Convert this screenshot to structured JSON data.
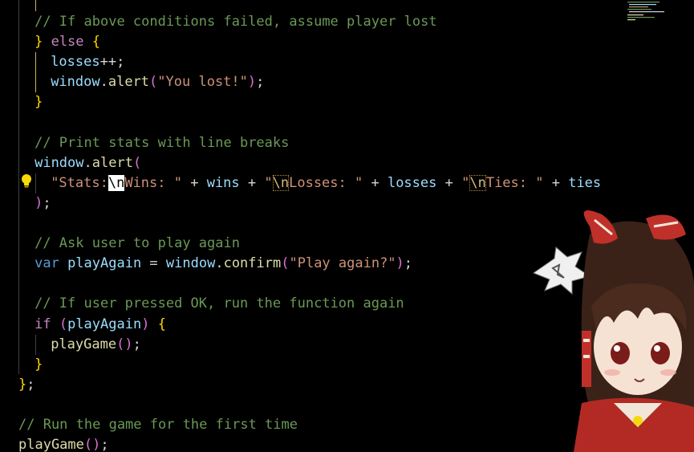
{
  "editor": {
    "lines": [
      {
        "tokens": [
          {
            "t": "// If above conditions failed, assume player lost",
            "c": "comment"
          }
        ]
      },
      {
        "tokens": [
          {
            "t": "} ",
            "c": "brace"
          },
          {
            "t": "else",
            "c": "control"
          },
          {
            "t": " {",
            "c": "brace"
          }
        ]
      },
      {
        "tokens": [
          {
            "t": "losses",
            "c": "var"
          },
          {
            "t": "++;",
            "c": "plain"
          }
        ]
      },
      {
        "tokens": [
          {
            "t": "window",
            "c": "var"
          },
          {
            "t": ".",
            "c": "plain"
          },
          {
            "t": "alert",
            "c": "func"
          },
          {
            "t": "(",
            "c": "paren"
          },
          {
            "t": "\"You lost!\"",
            "c": "string"
          },
          {
            "t": ")",
            "c": "paren"
          },
          {
            "t": ";",
            "c": "plain"
          }
        ]
      },
      {
        "tokens": [
          {
            "t": "}",
            "c": "brace"
          }
        ]
      },
      {
        "tokens": []
      },
      {
        "tokens": [
          {
            "t": "// Print stats with line breaks",
            "c": "comment"
          }
        ]
      },
      {
        "tokens": [
          {
            "t": "window",
            "c": "var"
          },
          {
            "t": ".",
            "c": "plain"
          },
          {
            "t": "alert",
            "c": "func"
          },
          {
            "t": "(",
            "c": "paren"
          }
        ]
      },
      {
        "tokens": [
          {
            "t": "\"Stats:",
            "c": "string"
          },
          {
            "t": "\\n",
            "c": "escape-cursor"
          },
          {
            "t": "Wins: \"",
            "c": "string"
          },
          {
            "t": " + ",
            "c": "plain"
          },
          {
            "t": "wins",
            "c": "var"
          },
          {
            "t": " + ",
            "c": "plain"
          },
          {
            "t": "\"",
            "c": "string"
          },
          {
            "t": "\\n",
            "c": "escape-box"
          },
          {
            "t": "Losses: \"",
            "c": "string"
          },
          {
            "t": " + ",
            "c": "plain"
          },
          {
            "t": "losses",
            "c": "var"
          },
          {
            "t": " + ",
            "c": "plain"
          },
          {
            "t": "\"",
            "c": "string"
          },
          {
            "t": "\\n",
            "c": "escape-box"
          },
          {
            "t": "Ties: \"",
            "c": "string"
          },
          {
            "t": " + ",
            "c": "plain"
          },
          {
            "t": "ties",
            "c": "var"
          }
        ]
      },
      {
        "tokens": [
          {
            "t": ")",
            "c": "paren"
          },
          {
            "t": ";",
            "c": "plain"
          }
        ]
      },
      {
        "tokens": []
      },
      {
        "tokens": [
          {
            "t": "// Ask user to play again",
            "c": "comment"
          }
        ]
      },
      {
        "tokens": [
          {
            "t": "var",
            "c": "keyword"
          },
          {
            "t": " ",
            "c": "plain"
          },
          {
            "t": "playAgain",
            "c": "var"
          },
          {
            "t": " = ",
            "c": "plain"
          },
          {
            "t": "window",
            "c": "var"
          },
          {
            "t": ".",
            "c": "plain"
          },
          {
            "t": "confirm",
            "c": "func"
          },
          {
            "t": "(",
            "c": "paren"
          },
          {
            "t": "\"Play again?\"",
            "c": "string"
          },
          {
            "t": ")",
            "c": "paren"
          },
          {
            "t": ";",
            "c": "plain"
          }
        ]
      },
      {
        "tokens": []
      },
      {
        "tokens": [
          {
            "t": "// If user pressed OK, run the function again",
            "c": "comment"
          }
        ]
      },
      {
        "tokens": [
          {
            "t": "if",
            "c": "control"
          },
          {
            "t": " ",
            "c": "plain"
          },
          {
            "t": "(",
            "c": "paren"
          },
          {
            "t": "playAgain",
            "c": "var"
          },
          {
            "t": ")",
            "c": "paren"
          },
          {
            "t": " ",
            "c": "plain"
          },
          {
            "t": "{",
            "c": "brace"
          }
        ]
      },
      {
        "tokens": [
          {
            "t": "playGame",
            "c": "func"
          },
          {
            "t": "(",
            "c": "paren"
          },
          {
            "t": ")",
            "c": "paren"
          },
          {
            "t": ";",
            "c": "plain"
          }
        ]
      },
      {
        "tokens": [
          {
            "t": "}",
            "c": "brace"
          }
        ]
      },
      {
        "tokens": [
          {
            "t": "}",
            "c": "brace"
          },
          {
            "t": ";",
            "c": "plain"
          }
        ]
      },
      {
        "tokens": []
      },
      {
        "tokens": [
          {
            "t": "// Run the game for the first time",
            "c": "comment"
          }
        ]
      },
      {
        "tokens": [
          {
            "t": "playGame",
            "c": "func"
          },
          {
            "t": "(",
            "c": "paren"
          },
          {
            "t": ")",
            "c": "paren"
          },
          {
            "t": ";",
            "c": "plain"
          }
        ]
      }
    ]
  },
  "icons": {
    "lightbulb": "lightbulb-icon",
    "decoration": "anime-character-background"
  },
  "colors": {
    "background": "#000000",
    "comment": "#6a9955",
    "keyword": "#569cd6",
    "control": "#c586c0",
    "variable": "#9cdcfe",
    "function": "#dcdcaa",
    "string": "#ce9178",
    "escape": "#d7ba7d",
    "brace": "#ffd700",
    "paren": "#da70d6"
  }
}
